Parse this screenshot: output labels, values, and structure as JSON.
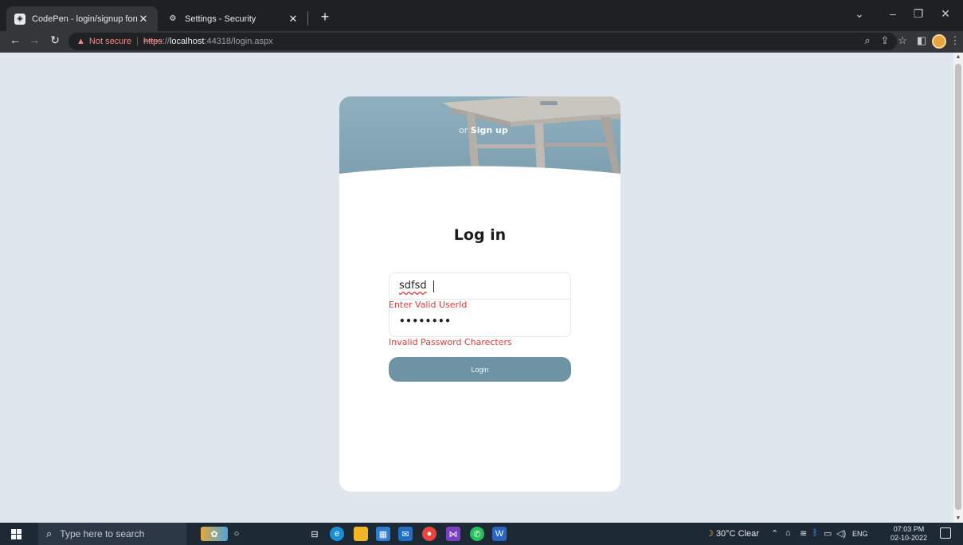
{
  "browser": {
    "tabs": [
      {
        "title": "CodePen - login/signup form ani",
        "active": true
      },
      {
        "title": "Settings - Security",
        "active": false
      }
    ],
    "new_tab": "+",
    "close_glyph": "✕",
    "url": {
      "warning": "Not secure",
      "scheme": "https",
      "sep": "://",
      "host": "localhost",
      "path": ":44318/login.aspx"
    }
  },
  "page": {
    "hero": {
      "prefix": "or",
      "link": "Sign up"
    },
    "heading": "Log in",
    "userid_value": "sdfsd",
    "userid_error": "Enter Valid UserId",
    "password_mask": "••••••••",
    "password_error": "Invalid Password Charecters",
    "login_button": "Login"
  },
  "taskbar": {
    "search_placeholder": "Type here to search",
    "weather": "30°C  Clear",
    "language": "ENG",
    "time": "07:03 PM",
    "date": "02-10-2022"
  },
  "colors": {
    "page_bg": "#dfe6ee",
    "button": "#6e93a4",
    "error": "#e53935",
    "hero": "#8fb0bf"
  }
}
